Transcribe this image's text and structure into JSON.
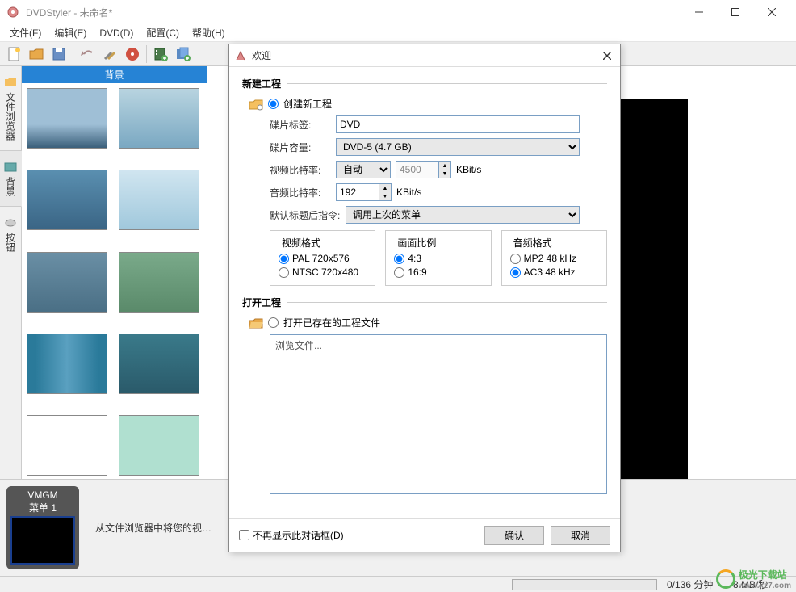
{
  "window": {
    "title": "DVDStyler - 未命名*"
  },
  "menubar": [
    {
      "label": "文件(F)"
    },
    {
      "label": "编辑(E)"
    },
    {
      "label": "DVD(D)"
    },
    {
      "label": "配置(C)"
    },
    {
      "label": "帮助(H)"
    }
  ],
  "sidetabs": {
    "browser": "文件浏览器",
    "background": "背景",
    "button": "按钮"
  },
  "bgpanel": {
    "header": "背景"
  },
  "timeline": {
    "vmgm": "VMGM",
    "menu1": "菜单 1",
    "hint": "从文件浏览器中将您的视…"
  },
  "statusbar": {
    "duration": "0/136 分钟",
    "bitrate": "8 MB/秒"
  },
  "watermark": {
    "text": "极光下载站",
    "url": "www.xz7.com"
  },
  "dialog": {
    "title": "欢迎",
    "section_new": "新建工程",
    "create_new": "创建新工程",
    "disc_label_lbl": "碟片标签:",
    "disc_label_val": "DVD",
    "capacity_lbl": "碟片容量:",
    "capacity_val": "DVD-5 (4.7 GB)",
    "vbitrate_lbl": "视频比特率:",
    "vbitrate_mode": "自动",
    "vbitrate_val": "4500",
    "vbitrate_unit": "KBit/s",
    "abitrate_lbl": "音频比特率:",
    "abitrate_val": "192",
    "abitrate_unit": "KBit/s",
    "posttitle_lbl": "默认标题后指令:",
    "posttitle_val": "调用上次的菜单",
    "videofmt_legend": "视频格式",
    "videofmt_pal": "PAL 720x576",
    "videofmt_ntsc": "NTSC 720x480",
    "aspect_legend": "画面比例",
    "aspect_43": "4:3",
    "aspect_169": "16:9",
    "audiofmt_legend": "音频格式",
    "audiofmt_mp2": "MP2 48 kHz",
    "audiofmt_ac3": "AC3 48 kHz",
    "section_open": "打开工程",
    "open_existing": "打开已存在的工程文件",
    "browse_placeholder": "浏览文件...",
    "dont_show": "不再显示此对话框(D)",
    "ok": "确认",
    "cancel": "取消"
  }
}
